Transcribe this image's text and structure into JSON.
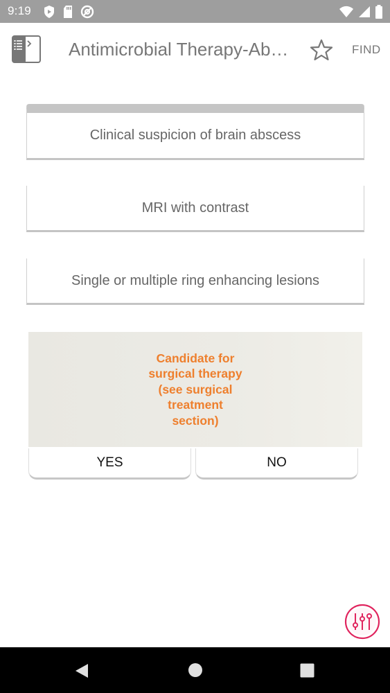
{
  "status_bar": {
    "time": "9:19",
    "left_icons": [
      "shield-play-icon",
      "sd-card-icon",
      "at-sign-icon"
    ],
    "right_icons": [
      "wifi-icon",
      "signal-icon",
      "battery-icon"
    ]
  },
  "app_bar": {
    "title": "Antimicrobial Therapy-Abscess",
    "find_label": "FIND",
    "icons": [
      "table-of-contents-icon",
      "star-outline-icon"
    ]
  },
  "flowchart": {
    "steps": [
      {
        "label": "Clinical suspicion of brain abscess"
      },
      {
        "label": "MRI with contrast"
      },
      {
        "label": "Single or multiple ring enhancing lesions"
      }
    ],
    "decision": {
      "label": "Candidate for surgical therapy (see surgical treatment section)",
      "yes_label": "YES",
      "no_label": "NO"
    }
  },
  "fab": {
    "icon": "sliders-icon"
  },
  "nav_bar": {
    "icons": [
      "back-triangle-icon",
      "home-circle-icon",
      "recents-square-icon"
    ]
  },
  "colors": {
    "status_bar": "#9e9e9e",
    "decision_text": "#ee7f2d",
    "decision_bg": "#ebeae4",
    "fab_accent": "#e0245e",
    "nav_bar": "#000000"
  }
}
